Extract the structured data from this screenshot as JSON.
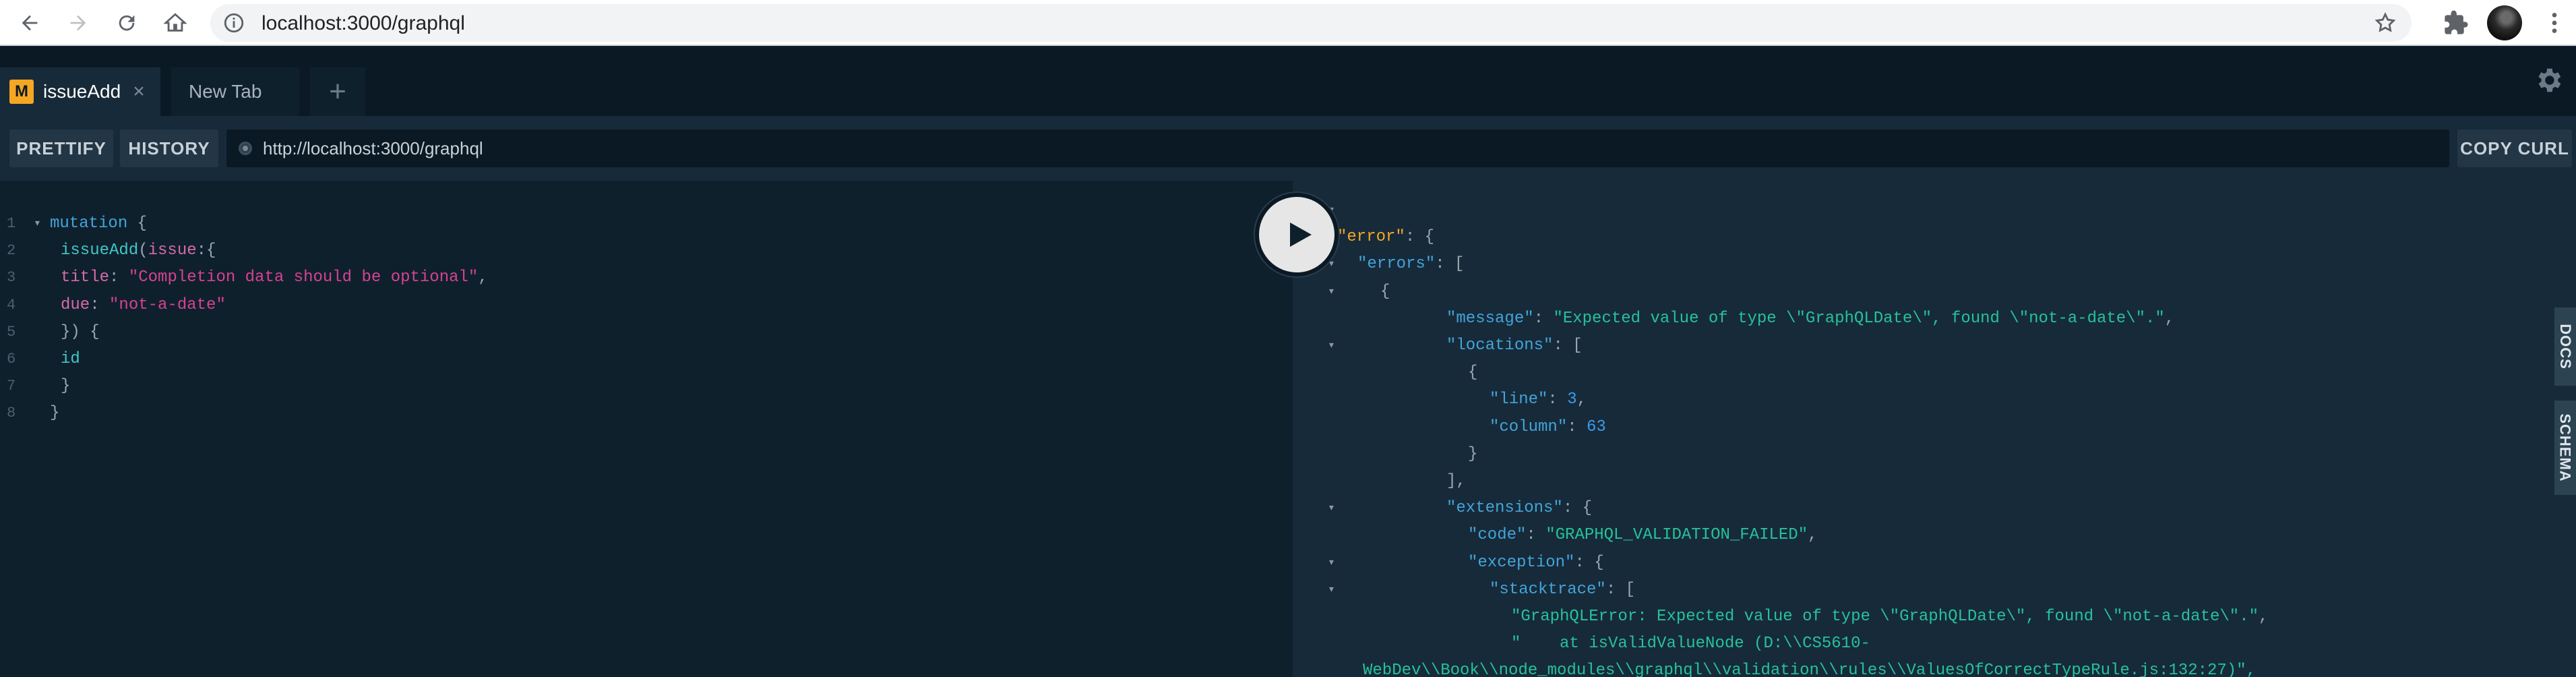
{
  "browser": {
    "url": "localhost:3000/graphql",
    "icons": [
      "back-arrow-icon",
      "forward-arrow-icon",
      "reload-icon",
      "home-icon",
      "info-icon",
      "star-icon",
      "puzzle-icon",
      "kebab-menu-icon"
    ]
  },
  "tabs": [
    {
      "badge": "M",
      "label": "issueAdd",
      "close": "×"
    },
    {
      "label": "New Tab"
    }
  ],
  "add_tab": "+",
  "toolbar": {
    "prettify": "PRETTIFY",
    "history": "HISTORY",
    "endpoint": "http://localhost:3000/graphql",
    "copy_curl": "COPY CURL"
  },
  "query": {
    "line_numbers": [
      "1",
      "2",
      "3",
      "4",
      "5",
      "6",
      "7",
      "8"
    ],
    "lines": [
      [
        {
          "t": "mutation",
          "c": "kw"
        },
        {
          "t": " {",
          "c": "pun"
        }
      ],
      [
        {
          "t": "issueAdd",
          "c": "fn"
        },
        {
          "t": "(",
          "c": "pun"
        },
        {
          "t": "issue",
          "c": "var"
        },
        {
          "t": ":{",
          "c": "pun"
        }
      ],
      [
        {
          "t": "title",
          "c": "var"
        },
        {
          "t": ": ",
          "c": "pun"
        },
        {
          "t": "\"Completion data should be optional\"",
          "c": "str"
        },
        {
          "t": ",",
          "c": "pun"
        }
      ],
      [
        {
          "t": "due",
          "c": "var"
        },
        {
          "t": ": ",
          "c": "pun"
        },
        {
          "t": "\"not-a-date\"",
          "c": "str"
        }
      ],
      [
        {
          "t": "}) {",
          "c": "pun"
        }
      ],
      [
        {
          "t": "id",
          "c": "fn"
        }
      ],
      [
        {
          "t": "}",
          "c": "pun"
        }
      ],
      [
        {
          "t": "}",
          "c": "pun"
        }
      ]
    ]
  },
  "result": {
    "lines": [
      [
        {
          "t": "{",
          "c": "pun"
        }
      ],
      [
        {
          "t": "\"error\"",
          "c": "key-err"
        },
        {
          "t": ": {",
          "c": "pun"
        }
      ],
      [
        {
          "t": "\"errors\"",
          "c": "key"
        },
        {
          "t": ": [",
          "c": "pun"
        }
      ],
      [
        {
          "t": "{",
          "c": "pun"
        }
      ],
      [
        {
          "t": "\"message\"",
          "c": "key"
        },
        {
          "t": ": ",
          "c": "pun"
        },
        {
          "t": "\"Expected value of type \\\"GraphQLDate\\\", found \\\"not-a-date\\\".\"",
          "c": "rstr"
        },
        {
          "t": ",",
          "c": "pun"
        }
      ],
      [
        {
          "t": "\"locations\"",
          "c": "key"
        },
        {
          "t": ": [",
          "c": "pun"
        }
      ],
      [
        {
          "t": "{",
          "c": "pun"
        }
      ],
      [
        {
          "t": "\"line\"",
          "c": "key"
        },
        {
          "t": ": ",
          "c": "pun"
        },
        {
          "t": "3",
          "c": "num"
        },
        {
          "t": ",",
          "c": "pun"
        }
      ],
      [
        {
          "t": "\"column\"",
          "c": "key"
        },
        {
          "t": ": ",
          "c": "pun"
        },
        {
          "t": "63",
          "c": "num"
        }
      ],
      [
        {
          "t": "}",
          "c": "pun"
        }
      ],
      [
        {
          "t": "],",
          "c": "pun"
        }
      ],
      [
        {
          "t": "\"extensions\"",
          "c": "key"
        },
        {
          "t": ": {",
          "c": "pun"
        }
      ],
      [
        {
          "t": "\"code\"",
          "c": "key"
        },
        {
          "t": ": ",
          "c": "pun"
        },
        {
          "t": "\"GRAPHQL_VALIDATION_FAILED\"",
          "c": "rstr"
        },
        {
          "t": ",",
          "c": "pun"
        }
      ],
      [
        {
          "t": "\"exception\"",
          "c": "key"
        },
        {
          "t": ": {",
          "c": "pun"
        }
      ],
      [
        {
          "t": "\"stacktrace\"",
          "c": "key"
        },
        {
          "t": ": [",
          "c": "pun"
        }
      ],
      [
        {
          "t": "\"GraphQLError: Expected value of type \\\"GraphQLDate\\\", found \\\"not-a-date\\\".\"",
          "c": "rstr"
        },
        {
          "t": ",",
          "c": "pun"
        }
      ],
      [
        {
          "t": "\"    at isValidValueNode (D:\\\\CS5610-",
          "c": "rstr"
        }
      ],
      [
        {
          "t": "WebDev\\\\Book\\\\node_modules\\\\graphql\\\\validation\\\\rules\\\\ValuesOfCorrectTypeRule.js:132:27)\",",
          "c": "rstr"
        }
      ]
    ]
  },
  "side_tabs": {
    "docs": "DOCS",
    "schema": "SCHEMA"
  }
}
